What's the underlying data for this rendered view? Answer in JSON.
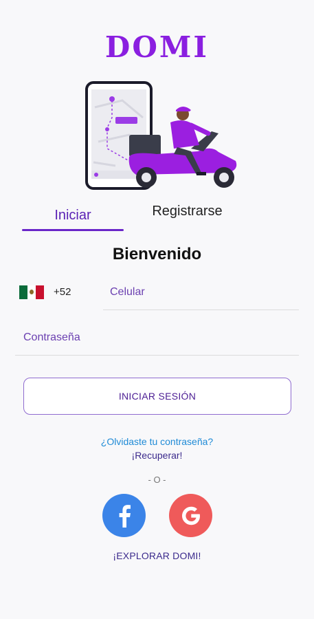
{
  "app": {
    "logo": "DOMI"
  },
  "tabs": [
    {
      "label": "Iniciar",
      "active": true
    },
    {
      "label": "Registrarse",
      "active": false
    }
  ],
  "welcome": "Bienvenido",
  "phone": {
    "country_flag": "mexico-flag-icon",
    "country_code": "+52",
    "placeholder": "Celular",
    "value": ""
  },
  "password": {
    "placeholder": "Contraseña",
    "value": ""
  },
  "login_button": "INICIAR SESIÓN",
  "forgot_password": "¿Olvidaste tu contraseña?",
  "recover": "¡Recuperar!",
  "divider": "- O -",
  "social": [
    {
      "name": "facebook",
      "icon": "facebook-icon",
      "color": "#3b84e8"
    },
    {
      "name": "google",
      "icon": "google-icon",
      "color": "#ef5a5a"
    }
  ],
  "explore": "¡EXPLORAR DOMI!",
  "colors": {
    "brand": "#8a1fe0",
    "accent": "#6a26c9",
    "link": "#1e8ad6"
  }
}
